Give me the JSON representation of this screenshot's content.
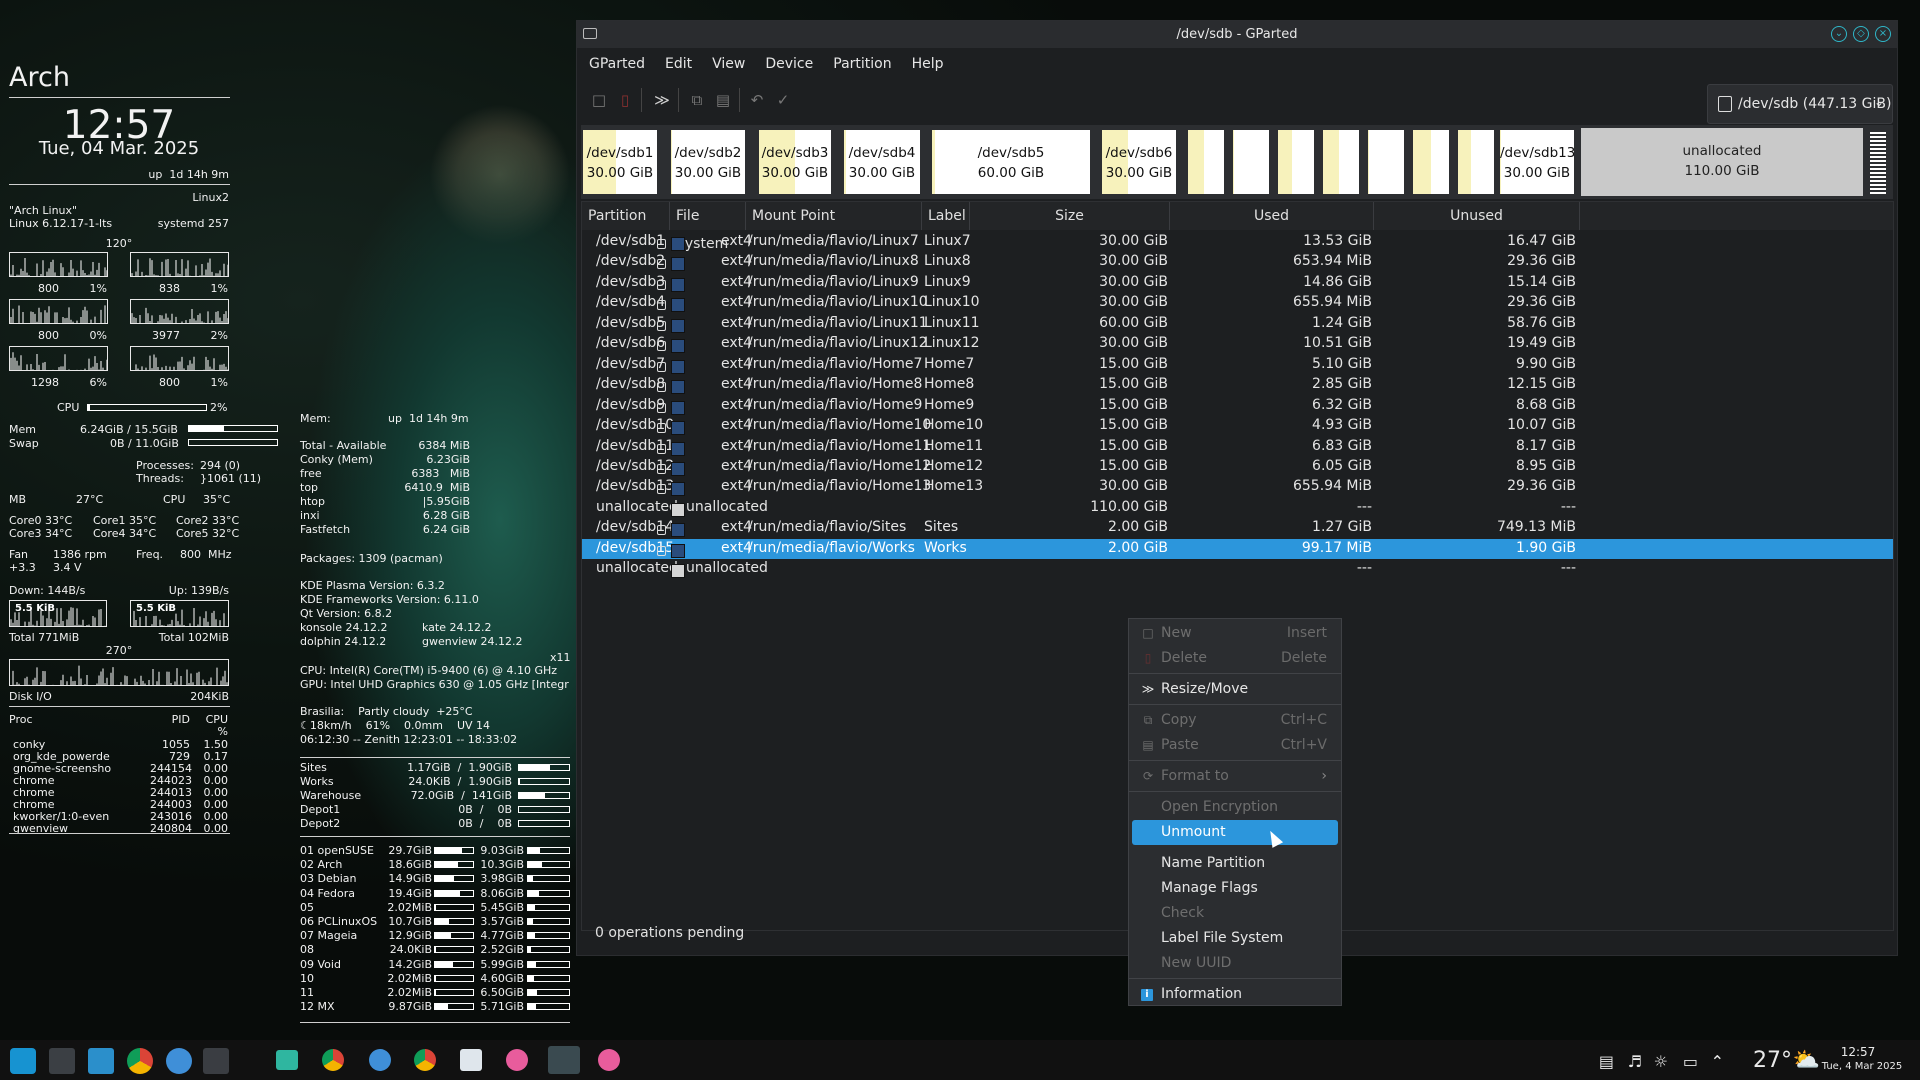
{
  "conky": {
    "distro": "Arch",
    "time": "12:57",
    "date": "Tue, 04 Mar. 2025",
    "uptime": "up  1d 14h 9m",
    "linux2": "Linux2",
    "os_name": "\"Arch Linux\"",
    "kernel": "Linux 6.12.17-1-lts",
    "systemd": "systemd 257",
    "temp120": "120°",
    "cores": [
      [
        "800",
        "1%",
        "838",
        "1%"
      ],
      [
        "800",
        "0%",
        "3977",
        "2%"
      ],
      [
        "1298",
        "6%",
        "800",
        "1%"
      ]
    ],
    "cpu_label": "CPU",
    "cpu_pct": "2%",
    "cpu_level": 0.02,
    "mem_label": "Mem",
    "mem_val": "6.24GiB / 15.5GiB",
    "mem_level": 0.4,
    "swap_label": "Swap",
    "swap_val": "0B / 11.0GiB",
    "swap_level": 0,
    "processes": "Processes:",
    "processes_val": "294 (0)",
    "threads": "Threads:",
    "threads_val": "}1061 (11)",
    "mb": "MB",
    "mb_temp": "27°C",
    "cpu_t": "CPU",
    "cpu_temp": "35°C",
    "core_temps": [
      [
        "Core0 33°C",
        "Core1 35°C",
        "Core2 33°C"
      ],
      [
        "Core3 34°C",
        "Core4 34°C",
        "Core5 32°C"
      ]
    ],
    "fan": "Fan",
    "fan_rpm": "1386 rpm",
    "freq": "Freq.",
    "freq_val": "800  MHz",
    "v1": "+3.3",
    "v2": "3.4 V",
    "down": "Down: 144B/s",
    "up": "Up: 139B/s",
    "down_g": "5.5 KiB",
    "up_g": "5.5 KiB",
    "total_d": "Total 771MiB",
    "total_u": "Total 102MiB",
    "temp270": "270°",
    "disk_io": "Disk I/O",
    "disk_io_val": "204KiB",
    "proc_h": [
      "Proc",
      "PID",
      "CPU",
      "%"
    ],
    "procs": [
      [
        "conky",
        "1055",
        "1.50"
      ],
      [
        "org_kde_powerde",
        "729",
        "0.17"
      ],
      [
        "gnome-screensho",
        "244154",
        "0.00"
      ],
      [
        "chrome",
        "244023",
        "0.00"
      ],
      [
        "chrome",
        "244013",
        "0.00"
      ],
      [
        "chrome",
        "244003",
        "0.00"
      ],
      [
        "kworker/1:0-even",
        "243016",
        "0.00"
      ],
      [
        "gwenview",
        "240804",
        "0.00"
      ]
    ],
    "mem2_h": "Mem:",
    "mem2_up": "up  1d 14h 9m",
    "memlist": [
      [
        "Total - Available",
        "6384 MiB"
      ],
      [
        "Conky (Mem)",
        "6.23GiB"
      ],
      [
        "free",
        "6383   MiB"
      ],
      [
        "top",
        "6410.9  MiB"
      ],
      [
        "htop",
        "|5.95GiB"
      ],
      [
        "inxi",
        "6.28 GiB"
      ],
      [
        "Fastfetch",
        "6.24 GiB"
      ]
    ],
    "packages": "Packages: 1309 (pacman)",
    "versions": [
      "KDE Plasma Version: 6.3.2",
      "KDE Frameworks Version: 6.11.0",
      "Qt Version: 6.8.2",
      "konsole 24.12.2",
      "dolphin 24.12.2"
    ],
    "kate": "kate 24.12.2",
    "gwenview": "gwenview 24.12.2",
    "x11": "x11",
    "cpu_info": "CPU: Intel(R) Core(TM) i5-9400 (6) @ 4.10 GHz",
    "gpu_info": "GPU: Intel UHD Graphics 630 @ 1.05 GHz [Integr",
    "weather": [
      "Brasilia:    Partly cloudy  +25°C",
      "☾18km/h    61%    0.0mm    UV 14",
      "06:12:30 -- Zenith 12:23:01 -- 18:33:02"
    ],
    "mounts": [
      [
        "Sites",
        "1.17GiB  /  1.90GiB",
        0.62
      ],
      [
        "Works",
        "24.0KiB  /  1.90GiB",
        0.02
      ],
      [
        "Warehouse",
        "72.0GiB  /  141GiB",
        0.51
      ],
      [
        "Depot1",
        "0B  /    0B",
        0
      ],
      [
        "Depot2",
        "0B  /    0B",
        0
      ]
    ],
    "systems": [
      [
        "01 openSUSE",
        "29.7GiB",
        "9.03GiB",
        0.7,
        0.3
      ],
      [
        "02 Arch",
        "18.6GiB",
        "10.3GiB",
        0.6,
        0.34
      ],
      [
        "03 Debian",
        "14.9GiB",
        "3.98GiB",
        0.5,
        0.13
      ],
      [
        "04 Fedora",
        "19.4GiB",
        "8.06GiB",
        0.65,
        0.27
      ],
      [
        "05",
        "2.02MiB",
        "5.45GiB",
        0.02,
        0.18
      ],
      [
        "06 PCLinuxOS",
        "10.7GiB",
        "3.57GiB",
        0.36,
        0.12
      ],
      [
        "07 Mageia",
        "12.9GiB",
        "4.77GiB",
        0.43,
        0.16
      ],
      [
        "08",
        "24.0KiB",
        "2.52GiB",
        0.01,
        0.08
      ],
      [
        "09 Void",
        "14.2GiB",
        "5.99GiB",
        0.47,
        0.2
      ],
      [
        "10",
        "2.02MiB",
        "4.60GiB",
        0.02,
        0.15
      ],
      [
        "11",
        "2.02MiB",
        "6.50GiB",
        0.02,
        0.22
      ],
      [
        "12 MX",
        "9.87GiB",
        "5.71GiB",
        0.33,
        0.19
      ]
    ]
  },
  "gparted": {
    "title": "/dev/sdb - GParted",
    "menus": [
      "GParted",
      "Edit",
      "View",
      "Device",
      "Partition",
      "Help"
    ],
    "device": "/dev/sdb (447.13 GiB)",
    "map": [
      [
        "/dev/sdb1",
        "30.00 GiB",
        0.45
      ],
      [
        "/dev/sdb2",
        "30.00 GiB",
        0.02
      ],
      [
        "/dev/sdb3",
        "30.00 GiB",
        0.5
      ],
      [
        "/dev/sdb4",
        "30.00 GiB",
        0.02
      ],
      [
        "/dev/sdb5",
        "60.00 GiB",
        0.02
      ],
      [
        "/dev/sdb6",
        "30.00 GiB",
        0.35
      ]
    ],
    "map2": [
      [
        "/dev/sdb13",
        "30.00 GiB"
      ]
    ],
    "map_unalloc": [
      "unallocated",
      "110.00 GiB"
    ],
    "columns": [
      "Partition",
      "File System",
      "Mount Point",
      "Label",
      "Size",
      "Used",
      "Unused"
    ],
    "rows": [
      [
        "/dev/sdb1",
        "ext4",
        "/run/media/flavio/Linux7",
        "Linux7",
        "30.00 GiB",
        "13.53 GiB",
        "16.47 GiB"
      ],
      [
        "/dev/sdb2",
        "ext4",
        "/run/media/flavio/Linux8",
        "Linux8",
        "30.00 GiB",
        "653.94 MiB",
        "29.36 GiB"
      ],
      [
        "/dev/sdb3",
        "ext4",
        "/run/media/flavio/Linux9",
        "Linux9",
        "30.00 GiB",
        "14.86 GiB",
        "15.14 GiB"
      ],
      [
        "/dev/sdb4",
        "ext4",
        "/run/media/flavio/Linux10",
        "Linux10",
        "30.00 GiB",
        "655.94 MiB",
        "29.36 GiB"
      ],
      [
        "/dev/sdb5",
        "ext4",
        "/run/media/flavio/Linux11",
        "Linux11",
        "60.00 GiB",
        "1.24 GiB",
        "58.76 GiB"
      ],
      [
        "/dev/sdb6",
        "ext4",
        "/run/media/flavio/Linux12",
        "Linux12",
        "30.00 GiB",
        "10.51 GiB",
        "19.49 GiB"
      ],
      [
        "/dev/sdb7",
        "ext4",
        "/run/media/flavio/Home7",
        "Home7",
        "15.00 GiB",
        "5.10 GiB",
        "9.90 GiB"
      ],
      [
        "/dev/sdb8",
        "ext4",
        "/run/media/flavio/Home8",
        "Home8",
        "15.00 GiB",
        "2.85 GiB",
        "12.15 GiB"
      ],
      [
        "/dev/sdb9",
        "ext4",
        "/run/media/flavio/Home9",
        "Home9",
        "15.00 GiB",
        "6.32 GiB",
        "8.68 GiB"
      ],
      [
        "/dev/sdb10",
        "ext4",
        "/run/media/flavio/Home10",
        "Home10",
        "15.00 GiB",
        "4.93 GiB",
        "10.07 GiB"
      ],
      [
        "/dev/sdb11",
        "ext4",
        "/run/media/flavio/Home11",
        "Home11",
        "15.00 GiB",
        "6.83 GiB",
        "8.17 GiB"
      ],
      [
        "/dev/sdb12",
        "ext4",
        "/run/media/flavio/Home12",
        "Home12",
        "15.00 GiB",
        "6.05 GiB",
        "8.95 GiB"
      ],
      [
        "/dev/sdb13",
        "ext4",
        "/run/media/flavio/Home13",
        "Home13",
        "30.00 GiB",
        "655.94 MiB",
        "29.36 GiB"
      ],
      [
        "unallocated",
        "unallocated",
        "",
        "",
        "110.00 GiB",
        "---",
        "---"
      ],
      [
        "/dev/sdb14",
        "ext4",
        "/run/media/flavio/Sites",
        "Sites",
        "2.00 GiB",
        "1.27 GiB",
        "749.13 MiB"
      ],
      [
        "/dev/sdb15",
        "ext4",
        "/run/media/flavio/Works",
        "Works",
        "2.00 GiB",
        "99.17 MiB",
        "1.90 GiB"
      ],
      [
        "unallocated",
        "unallocated",
        "",
        "",
        "",
        "---",
        "---"
      ]
    ],
    "status": "0 operations pending"
  },
  "context_menu": {
    "new": "New",
    "new_sc": "Insert",
    "delete": "Delete",
    "delete_sc": "Delete",
    "resize": "Resize/Move",
    "copy": "Copy",
    "copy_sc": "Ctrl+C",
    "paste": "Paste",
    "paste_sc": "Ctrl+V",
    "format": "Format to",
    "open_enc": "Open Encryption",
    "unmount": "Unmount",
    "name_part": "Name Partition",
    "flags": "Manage Flags",
    "check": "Check",
    "label_fs": "Label File System",
    "new_uuid": "New UUID",
    "info": "Information"
  },
  "tray": {
    "temp": "27°",
    "time": "12:57",
    "date": "Tue, 4 Mar 2025"
  },
  "colors": {
    "accent": "#2c96dc",
    "used_fill": "#f7f2bc",
    "ext4": "#2a4c7c"
  }
}
